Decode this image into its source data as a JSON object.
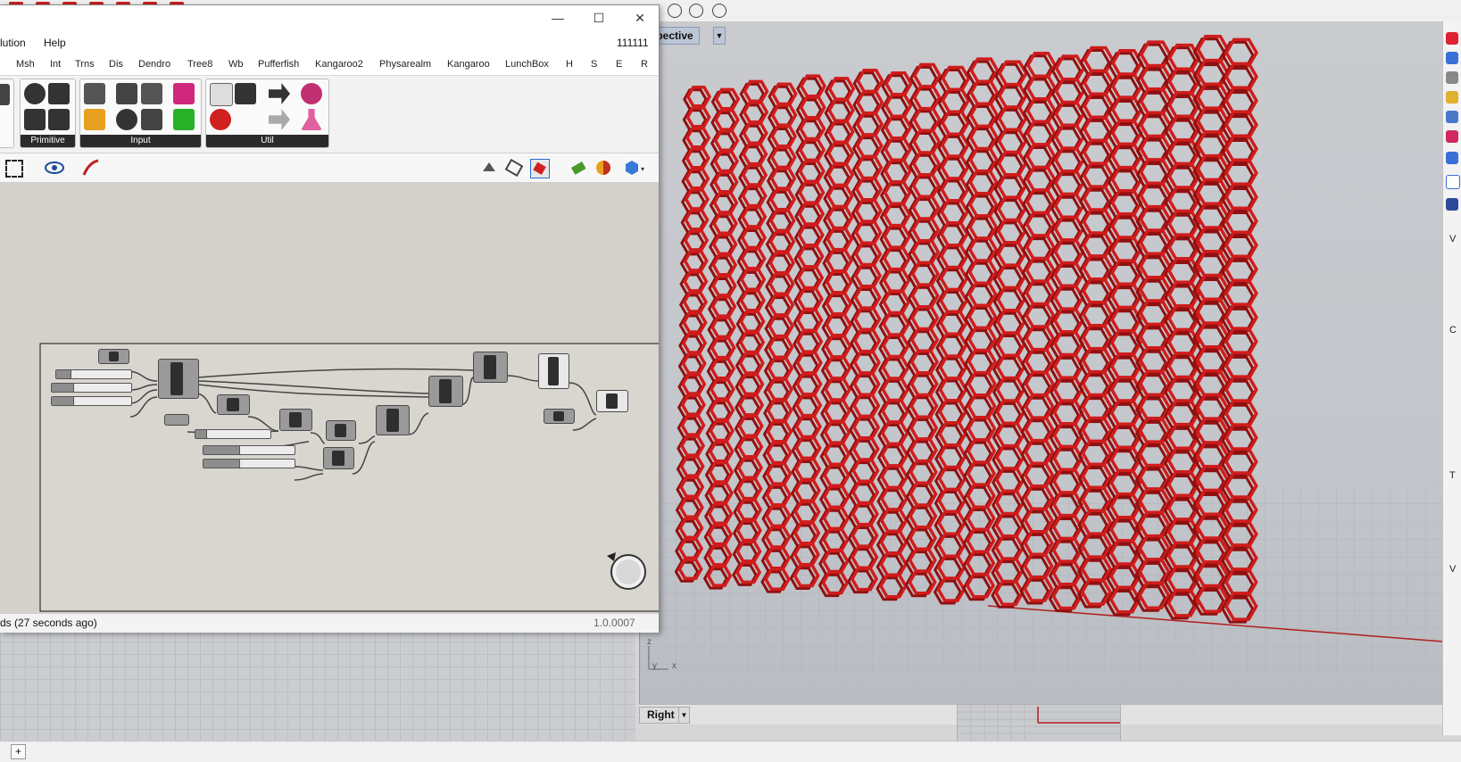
{
  "rhino": {
    "viewport_main_label": "rspective",
    "viewport_secondary_label": "Right",
    "axes": {
      "z": "z",
      "y": "y",
      "x": "x"
    },
    "right_strip_letters": [
      "V",
      "C",
      "T",
      "V"
    ]
  },
  "gh": {
    "window_buttons": {
      "minimize": "—",
      "maximize": "☐",
      "close": "✕"
    },
    "menu": {
      "solution": "lution",
      "help": "Help",
      "doc_name": "111111"
    },
    "tabs": [
      "Msh",
      "Int",
      "Trns",
      "Dis",
      "Dendro",
      "Tree8",
      "Wb",
      "Pufferfish",
      "Kangaroo2",
      "Physarealm",
      "Kangaroo",
      "LunchBox",
      "H",
      "S",
      "E",
      "R"
    ],
    "ribbon_panels": {
      "primitive": "Primitive",
      "input": "Input",
      "util": "Util"
    },
    "status_left": "ds (27 seconds ago)",
    "version": "1.0.0007"
  },
  "colors": {
    "mesh_red": "#d01c1c",
    "canvas_bg": "#d4d1ca",
    "viewport_bg": "#c6c9ce",
    "active_tab": "#bcc6d6"
  }
}
